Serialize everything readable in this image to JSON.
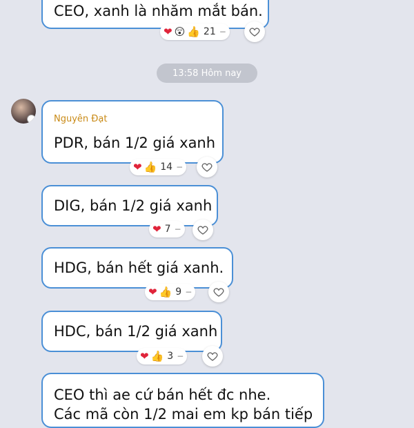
{
  "header_partial_message": {
    "text": "CEO, xanh là nhăm mắt bán.",
    "reaction_count": "21"
  },
  "time_divider": "13:58 Hôm nay",
  "sender": {
    "name": "Nguyên Đạt"
  },
  "messages": [
    {
      "text": "PDR, bán 1/2 giá xanh",
      "reaction_count": "14"
    },
    {
      "text": "DIG, bán 1/2 giá xanh",
      "reaction_count": "7"
    },
    {
      "text": "HDG, bán hết giá xanh.",
      "reaction_count": "9"
    },
    {
      "text": "HDC, bán 1/2 giá xanh",
      "reaction_count": "3"
    }
  ],
  "last_message": {
    "line1": "CEO thì ae cứ bán hết đc nhe.",
    "line2": "Các mã còn 1/2 mai em kp bán tiếp"
  },
  "colors": {
    "bubble_border": "#4a8fd6",
    "background": "#e3e5ed",
    "sender_name": "#c98a16",
    "heart": "#e0243a",
    "thumb": "#f2b01e"
  },
  "icons": [
    "heart-icon",
    "surprised-face-icon",
    "thumbs-up-icon",
    "heart-outline-icon"
  ]
}
